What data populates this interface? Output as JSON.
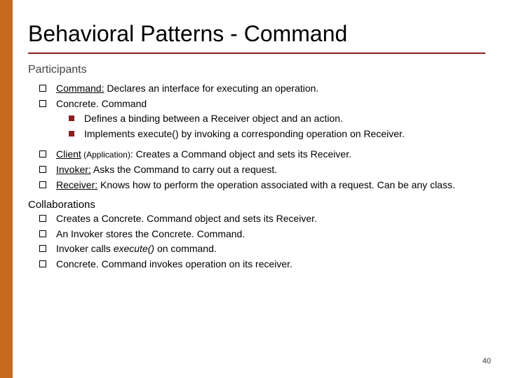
{
  "title": "Behavioral Patterns - Command",
  "section1": "Participants",
  "items": {
    "p1_term": "Command:",
    "p1_rest": " Declares an interface for executing an operation.",
    "p2": "Concrete. Command",
    "p2a": "Defines a binding between a Receiver object and an action.",
    "p2b": "Implements execute() by invoking a corresponding operation on Receiver.",
    "p3_term": "Client",
    "p3_paren": " (Application)",
    "p3_rest": ": Creates a Command object and sets its Receiver.",
    "p4_term": "Invoker:",
    "p4_rest": " Asks the Command to carry out a request.",
    "p5_term": "Receiver:",
    "p5_rest": " Knows how to perform the operation associated with a request. Can be any class."
  },
  "section2": "Collaborations",
  "collab": {
    "c1": "Creates a Concrete. Command object and sets its Receiver.",
    "c2": "An Invoker stores the Concrete. Command.",
    "c3a": "Invoker calls ",
    "c3b": "execute()",
    "c3c": " on command.",
    "c4": "Concrete. Command invokes operation on its receiver."
  },
  "page": "40"
}
